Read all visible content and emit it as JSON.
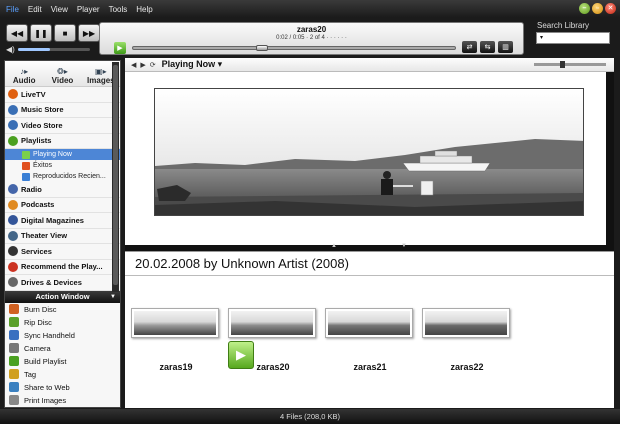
{
  "menu": [
    "File",
    "Edit",
    "View",
    "Player",
    "Tools",
    "Help"
  ],
  "window_buttons": {
    "min": "–",
    "max": "▫",
    "close": "✕"
  },
  "player": {
    "track_title": "zaras20",
    "time_line": "0:02 / 0:05 · 2 of 4 · · · · · ·",
    "progress_fraction": 0.4,
    "volume_fraction": 0.45
  },
  "search": {
    "label": "Search Library",
    "placeholder": "▾"
  },
  "sidebar": {
    "categories": [
      {
        "label": "Audio",
        "icon": "note-icon"
      },
      {
        "label": "Video",
        "icon": "film-icon"
      },
      {
        "label": "Images",
        "icon": "image-icon"
      }
    ],
    "nav": [
      {
        "label": "LiveTV",
        "icon": "tv-icon",
        "color": "#e06010"
      },
      {
        "label": "Music Store",
        "icon": "globe-icon",
        "color": "#3a6fb5"
      },
      {
        "label": "Video Store",
        "icon": "globe-icon",
        "color": "#3a6fb5"
      },
      {
        "label": "Playlists",
        "icon": "playlist-icon",
        "color": "#4aa020",
        "arrow": "▾"
      }
    ],
    "playlists": [
      {
        "label": "Playing Now",
        "color": "#7bd04a"
      },
      {
        "label": "Éxitos",
        "color": "#e05020"
      },
      {
        "label": "Reproducidos Recien...",
        "color": "#3a7fd5"
      }
    ],
    "nav2": [
      {
        "label": "Radio",
        "icon": "antenna-icon",
        "color": "#4466aa"
      },
      {
        "label": "Podcasts",
        "icon": "podcast-icon",
        "color": "#e08a20",
        "arrow": "▸"
      },
      {
        "label": "Digital Magazines",
        "icon": "magazine-icon",
        "color": "#335599"
      },
      {
        "label": "Theater View",
        "icon": "theater-icon",
        "color": "#446688"
      },
      {
        "label": "Services",
        "icon": "gear-icon",
        "color": "#333",
        "arrow": "▸"
      },
      {
        "label": "Recommend the Play...",
        "icon": "star-icon",
        "color": "#cc3322"
      },
      {
        "label": "Drives & Devices",
        "icon": "drive-icon",
        "color": "#666",
        "arrow": "▸"
      }
    ],
    "action_window": {
      "title": "Action Window",
      "items": [
        {
          "label": "Burn Disc",
          "color": "#d06020"
        },
        {
          "label": "Rip Disc",
          "color": "#5aa028"
        },
        {
          "label": "Sync Handheld",
          "color": "#3a70c0"
        },
        {
          "label": "Camera",
          "color": "#777"
        },
        {
          "label": "Build Playlist",
          "color": "#4aa020"
        },
        {
          "label": "Tag",
          "color": "#d0a020"
        },
        {
          "label": "Share to Web",
          "color": "#3a80c0"
        },
        {
          "label": "Print Images",
          "color": "#888"
        }
      ]
    }
  },
  "main": {
    "location": "Playing Now ▾",
    "header": "20.02.2008 by Unknown Artist (2008)",
    "thumbnails": [
      "zaras19",
      "zaras20",
      "zaras21",
      "zaras22"
    ],
    "playing_index": 1
  },
  "status": "4 Files (208,0 KB)"
}
